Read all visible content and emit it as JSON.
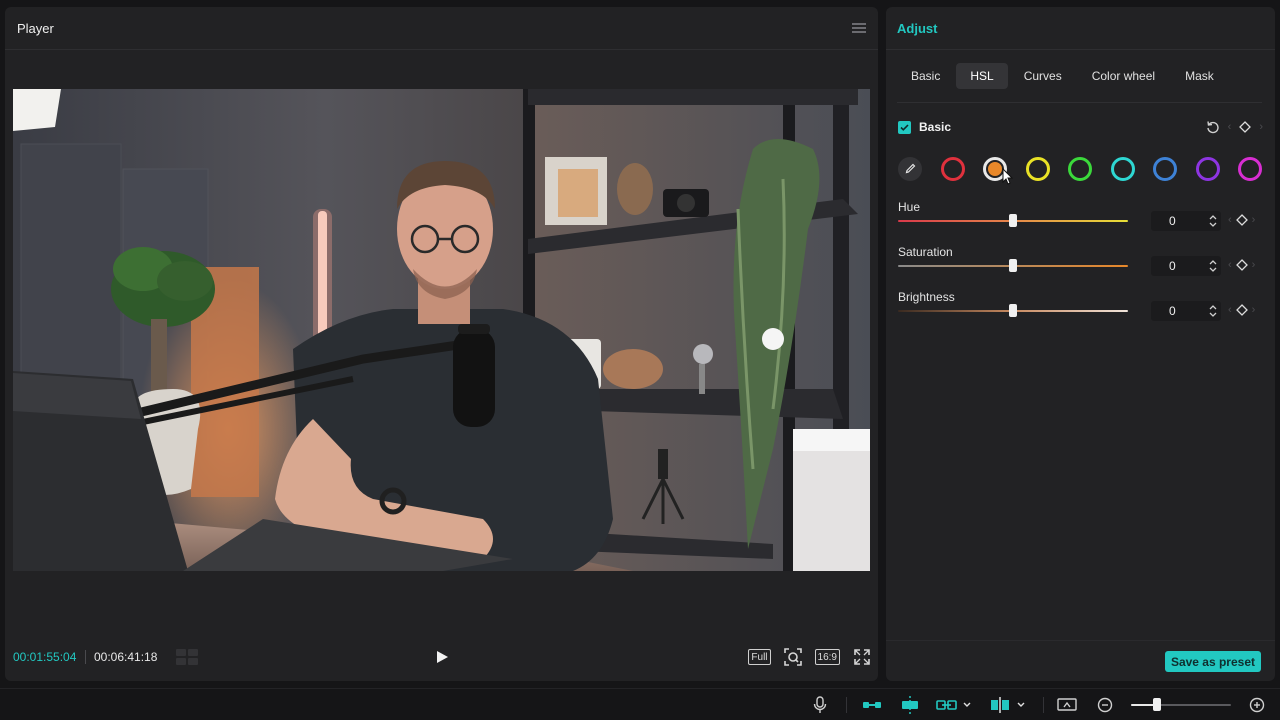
{
  "player": {
    "title": "Player",
    "timecode_current": "00:01:55:04",
    "timecode_total": "00:06:41:18",
    "full_label": "Full",
    "aspect_label": "16:9"
  },
  "adjust": {
    "title": "Adjust",
    "tabs": [
      {
        "label": "Basic",
        "active": false
      },
      {
        "label": "HSL",
        "active": true
      },
      {
        "label": "Curves",
        "active": false
      },
      {
        "label": "Color wheel",
        "active": false
      },
      {
        "label": "Mask",
        "active": false
      }
    ],
    "section_label": "Basic",
    "section_checked": true,
    "swatches": [
      {
        "name": "red",
        "color": "#e0313d",
        "selected": false
      },
      {
        "name": "orange",
        "color": "#e8882a",
        "selected": true
      },
      {
        "name": "yellow",
        "color": "#e9e226",
        "selected": false
      },
      {
        "name": "green",
        "color": "#3bd93b",
        "selected": false
      },
      {
        "name": "cyan",
        "color": "#2ed7d2",
        "selected": false
      },
      {
        "name": "blue",
        "color": "#3e82d6",
        "selected": false
      },
      {
        "name": "purple",
        "color": "#8e35e2",
        "selected": false
      },
      {
        "name": "magenta",
        "color": "#d82ed2",
        "selected": false
      }
    ],
    "sliders": [
      {
        "label": "Hue",
        "value": "0",
        "level": 0.5
      },
      {
        "label": "Saturation",
        "value": "0",
        "level": 0.5
      },
      {
        "label": "Brightness",
        "value": "0",
        "level": 0.5
      }
    ],
    "save_preset_label": "Save as preset"
  },
  "toolbar": {
    "zoom_level": 0.26
  },
  "colors": {
    "accent": "#22c8c1",
    "panel_bg": "#222224",
    "app_bg": "#151517"
  }
}
